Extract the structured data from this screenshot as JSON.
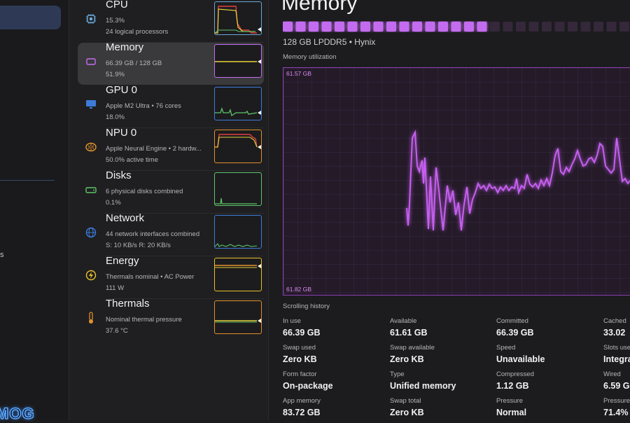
{
  "sidebar": {
    "fragment": "s",
    "logo": "MOG"
  },
  "list": {
    "items": [
      {
        "name": "CPU",
        "sub1": "15.3%",
        "sub2": "24 logical processors",
        "color": "#6aa8d8"
      },
      {
        "name": "Memory",
        "sub1": "66.39 GB / 128 GB",
        "sub2": "51.9%",
        "color": "#c46cf0"
      },
      {
        "name": "GPU 0",
        "sub1": "Apple M2 Ultra • 76 cores",
        "sub2": "18.0%",
        "color": "#3d7bd9"
      },
      {
        "name": "NPU 0",
        "sub1": "Apple Neural Engine • 2 hardw...",
        "sub2": "50.0% active time",
        "color": "#e0912c"
      },
      {
        "name": "Disks",
        "sub1": "6 physical disks combined",
        "sub2": "0.1%",
        "color": "#5ec46a"
      },
      {
        "name": "Network",
        "sub1": "44 network interfaces combined",
        "sub2": "S: 10 KB/s  R: 20 KB/s",
        "color": "#3d7bd9"
      },
      {
        "name": "Energy",
        "sub1": "Thermals nominal • AC Power",
        "sub2": "111 W",
        "color": "#e8c12c"
      },
      {
        "name": "Thermals",
        "sub1": "Nominal thermal pressure",
        "sub2": "37.6 °C",
        "color": "#e0912c"
      }
    ]
  },
  "main": {
    "title": "Memory",
    "usage_fraction": 0.519,
    "subtitle": "128 GB LPDDR5 • Hynix",
    "graph_caption": "Memory utilization",
    "graph_top_label": "61.57 GB",
    "graph_bottom_label": "61.82 GB",
    "scroll_caption": "Scrolling history",
    "stats": [
      {
        "label": "In use",
        "value": "66.39 GB"
      },
      {
        "label": "Available",
        "value": "61.61 GB"
      },
      {
        "label": "Committed",
        "value": "66.39 GB"
      },
      {
        "label": "Cached",
        "value": "33.02"
      },
      {
        "label": "Swap used",
        "value": "Zero KB"
      },
      {
        "label": "Swap available",
        "value": "Zero KB"
      },
      {
        "label": "Speed",
        "value": "Unavailable"
      },
      {
        "label": "Slots use",
        "value": "Integra"
      },
      {
        "label": "Form factor",
        "value": "On-package"
      },
      {
        "label": "Type",
        "value": "Unified memory"
      },
      {
        "label": "Compressed",
        "value": "1.12 GB"
      },
      {
        "label": "Wired",
        "value": "6.59 G"
      },
      {
        "label": "App memory",
        "value": "83.72 GB"
      },
      {
        "label": "Swap total",
        "value": "Zero KB"
      },
      {
        "label": "Pressure",
        "value": "Normal"
      },
      {
        "label": "Pressure",
        "value": "71.4%"
      }
    ]
  },
  "colors": {
    "accent": "#c46cf0",
    "selected_bg": "#3a3a3c",
    "sidebar_selected": "#2e3a55"
  }
}
